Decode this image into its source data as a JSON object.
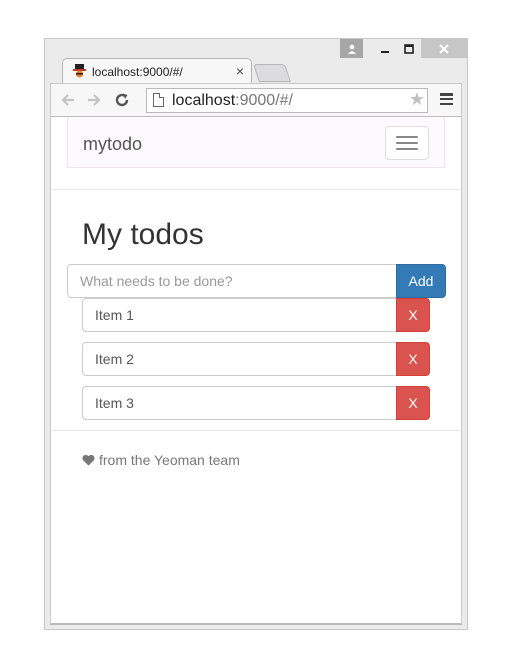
{
  "browser": {
    "tab_title": "localhost:9000/#/",
    "tab_close": "×",
    "url_host": "localhost",
    "url_path": ":9000/#/"
  },
  "app": {
    "brand": "mytodo",
    "heading": "My todos",
    "new_todo": {
      "placeholder": "What needs to be done?",
      "value": "",
      "add_label": "Add"
    },
    "todos": [
      {
        "text": "Item 1",
        "delete_label": "X"
      },
      {
        "text": "Item 2",
        "delete_label": "X"
      },
      {
        "text": "Item 3",
        "delete_label": "X"
      }
    ],
    "footer": "from the Yeoman team"
  },
  "colors": {
    "primary": "#337ab7",
    "danger": "#d9534f"
  }
}
